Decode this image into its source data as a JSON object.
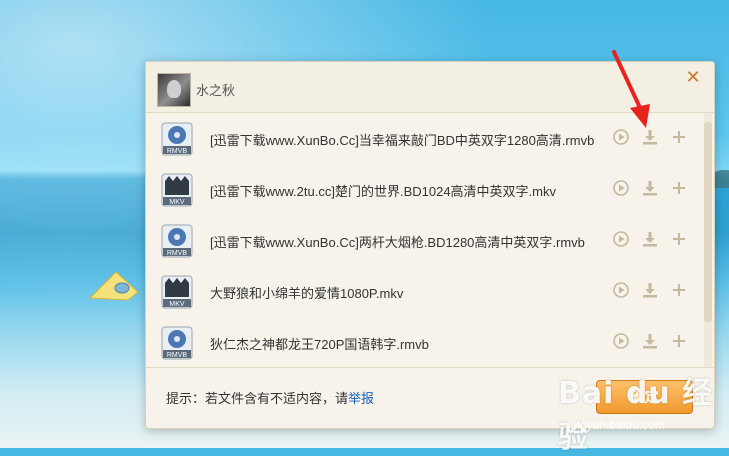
{
  "dialog": {
    "username": "水之秋",
    "close_glyph": "✕",
    "files": [
      {
        "name": "[迅雷下载www.XunBo.Cc]当幸福来敲门BD中英双字1280高清.rmvb",
        "type": "RMVB"
      },
      {
        "name": "[迅雷下载www.2tu.cc]楚门的世界.BD1024高清中英双字.mkv",
        "type": "MKV"
      },
      {
        "name": "[迅雷下载www.XunBo.Cc]两杆大烟枪.BD1280高清中英双字.rmvb",
        "type": "RMVB"
      },
      {
        "name": "大野狼和小绵羊的爱情1080P.mkv",
        "type": "MKV"
      },
      {
        "name": "狄仁杰之神都龙王720P国语韩字.rmvb",
        "type": "RMVB"
      }
    ],
    "footer": {
      "hint_prefix": "提示：若文件含有不适内容，请",
      "report_link": "举报",
      "confirm_label": "确定"
    }
  },
  "icons": {
    "play": "play-circle-icon",
    "download": "download-icon",
    "add": "plus-icon"
  },
  "watermark": {
    "text": "Bai du 经验",
    "sub": "jingyan.baidu.com"
  },
  "colors": {
    "accent": "#f29a2e",
    "link": "#1a5fb4",
    "close": "#c97a2a",
    "annotation_arrow": "#e8231e"
  }
}
